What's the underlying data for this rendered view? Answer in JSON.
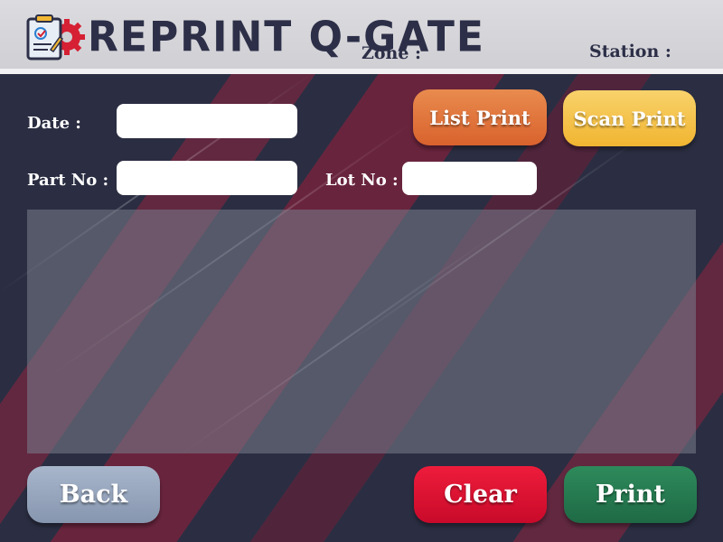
{
  "header": {
    "title": "REPRINT Q-GATE",
    "zone_label": "Zone :",
    "station_label": "Station :"
  },
  "form": {
    "date_label": "Date :",
    "date_value": "",
    "part_no_label": "Part No :",
    "part_no_value": "",
    "lot_no_label": "Lot No :",
    "lot_no_value": ""
  },
  "buttons": {
    "list_print": "List Print",
    "scan_print": "Scan Print",
    "back": "Back",
    "clear": "Clear",
    "print": "Print"
  },
  "colors": {
    "header_text": "#2c2f47",
    "background": "#2b2e42",
    "list_print": "#e07036",
    "scan_print": "#f4c24a",
    "back": "#97a6bf",
    "clear": "#e0112f",
    "print": "#25794f"
  },
  "icons": {
    "logo": "clipboard-gear-icon"
  }
}
